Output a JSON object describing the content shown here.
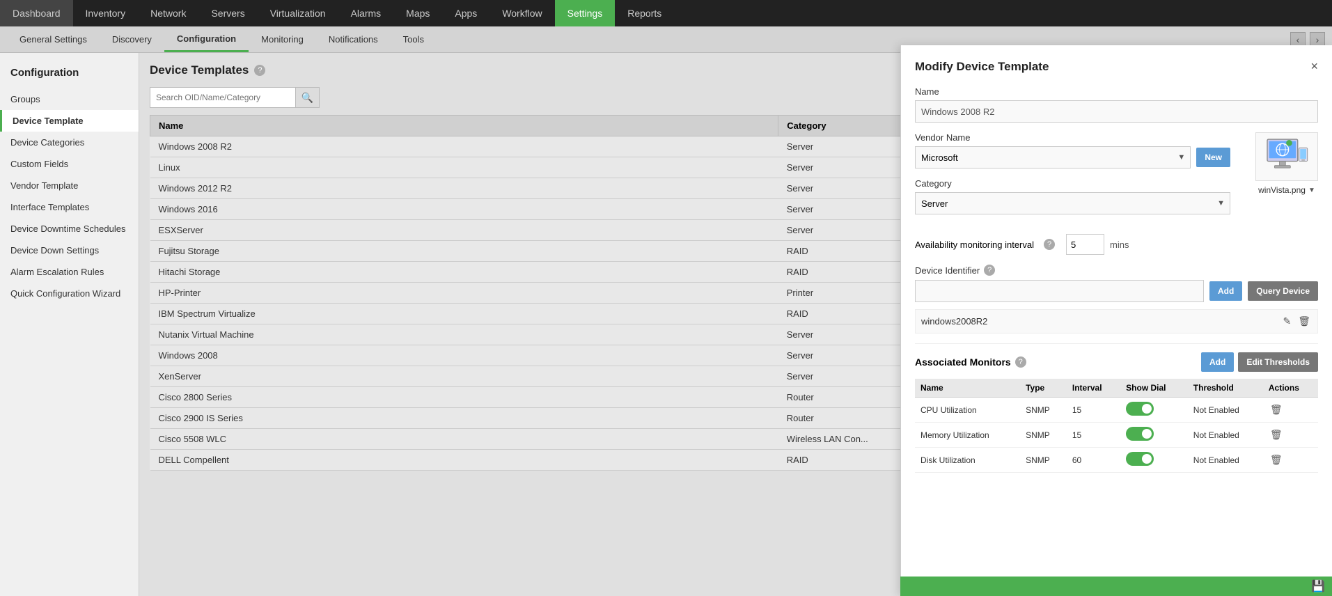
{
  "topNav": {
    "items": [
      {
        "label": "Dashboard",
        "active": false
      },
      {
        "label": "Inventory",
        "active": false
      },
      {
        "label": "Network",
        "active": false
      },
      {
        "label": "Servers",
        "active": false
      },
      {
        "label": "Virtualization",
        "active": false
      },
      {
        "label": "Alarms",
        "active": false
      },
      {
        "label": "Maps",
        "active": false
      },
      {
        "label": "Apps",
        "active": false
      },
      {
        "label": "Workflow",
        "active": false
      },
      {
        "label": "Settings",
        "active": true
      },
      {
        "label": "Reports",
        "active": false
      }
    ]
  },
  "subNav": {
    "items": [
      {
        "label": "General Settings",
        "active": false
      },
      {
        "label": "Discovery",
        "active": false
      },
      {
        "label": "Configuration",
        "active": true
      },
      {
        "label": "Monitoring",
        "active": false
      },
      {
        "label": "Notifications",
        "active": false
      },
      {
        "label": "Tools",
        "active": false
      }
    ]
  },
  "sidebar": {
    "title": "Configuration",
    "items": [
      {
        "label": "Groups",
        "active": false
      },
      {
        "label": "Device Template",
        "active": true
      },
      {
        "label": "Device Categories",
        "active": false
      },
      {
        "label": "Custom Fields",
        "active": false
      },
      {
        "label": "Vendor Template",
        "active": false
      },
      {
        "label": "Interface Templates",
        "active": false
      },
      {
        "label": "Device Downtime Schedules",
        "active": false
      },
      {
        "label": "Device Down Settings",
        "active": false
      },
      {
        "label": "Alarm Escalation Rules",
        "active": false
      },
      {
        "label": "Quick Configuration Wizard",
        "active": false
      }
    ]
  },
  "content": {
    "title": "Device Templates",
    "searchPlaceholder": "Search OID/Name/Category",
    "tableHeaders": [
      "Name",
      "Category"
    ],
    "tableRows": [
      {
        "name": "Windows 2008 R2",
        "category": "Server"
      },
      {
        "name": "Linux",
        "category": "Server"
      },
      {
        "name": "Windows 2012 R2",
        "category": "Server"
      },
      {
        "name": "Windows 2016",
        "category": "Server"
      },
      {
        "name": "ESXServer",
        "category": "Server"
      },
      {
        "name": "Fujitsu Storage",
        "category": "RAID"
      },
      {
        "name": "Hitachi Storage",
        "category": "RAID"
      },
      {
        "name": "HP-Printer",
        "category": "Printer"
      },
      {
        "name": "IBM Spectrum Virtualize",
        "category": "RAID"
      },
      {
        "name": "Nutanix Virtual Machine",
        "category": "Server"
      },
      {
        "name": "Windows 2008",
        "category": "Server"
      },
      {
        "name": "XenServer",
        "category": "Server"
      },
      {
        "name": "Cisco 2800 Series",
        "category": "Router"
      },
      {
        "name": "Cisco 2900 IS Series",
        "category": "Router"
      },
      {
        "name": "Cisco 5508 WLC",
        "category": "Wireless LAN Con..."
      },
      {
        "name": "DELL Compellent",
        "category": "RAID"
      }
    ]
  },
  "modal": {
    "title": "Modify Device Template",
    "closeLabel": "×",
    "fields": {
      "name": {
        "label": "Name",
        "value": "Windows 2008 R2"
      },
      "vendorName": {
        "label": "Vendor Name",
        "value": "Microsoft",
        "newButtonLabel": "New"
      },
      "category": {
        "label": "Category",
        "value": "Server"
      },
      "availabilityInterval": {
        "label": "Availability monitoring interval",
        "value": "5",
        "unit": "mins"
      },
      "deviceIdentifier": {
        "label": "Device Identifier",
        "placeholder": "",
        "addButtonLabel": "Add",
        "queryButtonLabel": "Query Device",
        "existingValue": "windows2008R2"
      },
      "imageFile": {
        "name": "winVista.png"
      }
    },
    "associatedMonitors": {
      "label": "Associated Monitors",
      "addButtonLabel": "Add",
      "editThresholdsLabel": "Edit Thresholds",
      "tableHeaders": [
        "Name",
        "Type",
        "Interval",
        "Show Dial",
        "Threshold",
        "Actions"
      ],
      "rows": [
        {
          "name": "CPU Utilization",
          "type": "SNMP",
          "interval": "15",
          "showDial": true,
          "threshold": "Not Enabled"
        },
        {
          "name": "Memory Utilization",
          "type": "SNMP",
          "interval": "15",
          "showDial": true,
          "threshold": "Not Enabled"
        },
        {
          "name": "Disk Utilization",
          "type": "SNMP",
          "interval": "60",
          "showDial": true,
          "threshold": "Not Enabled"
        }
      ]
    },
    "bottomBarIcon": "💾"
  }
}
